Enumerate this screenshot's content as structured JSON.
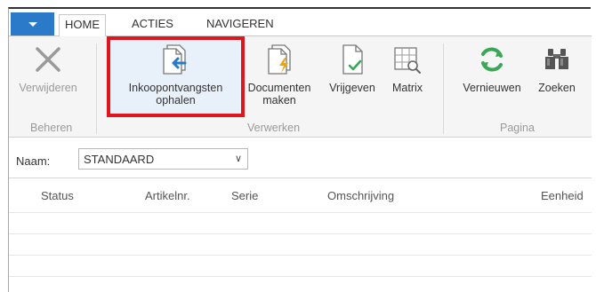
{
  "tabs": {
    "home": "HOME",
    "acties": "ACTIES",
    "navigeren": "NAVIGEREN"
  },
  "ribbon": {
    "buttons": {
      "verwijderen": "Verwijderen",
      "inkoopontvangsten_line1": "Inkoopontvangsten",
      "inkoopontvangsten_line2": "ophalen",
      "documenten_line1": "Documenten",
      "documenten_line2": "maken",
      "vrijgeven": "Vrijgeven",
      "matrix": "Matrix",
      "vernieuwen": "Vernieuwen",
      "zoeken": "Zoeken"
    },
    "groups": {
      "beheren": "Beheren",
      "verwerken": "Verwerken",
      "pagina": "Pagina"
    }
  },
  "filter": {
    "label": "Naam:",
    "value": "STANDAARD"
  },
  "grid": {
    "columns": [
      "Status",
      "Artikelnr.",
      "Serie",
      "Omschrijving",
      "Eenheid"
    ]
  },
  "colors": {
    "accent": "#2b79c9",
    "highlight": "#e0151e",
    "refresh_green": "#3aa757",
    "lightning_orange": "#f0a30a"
  }
}
